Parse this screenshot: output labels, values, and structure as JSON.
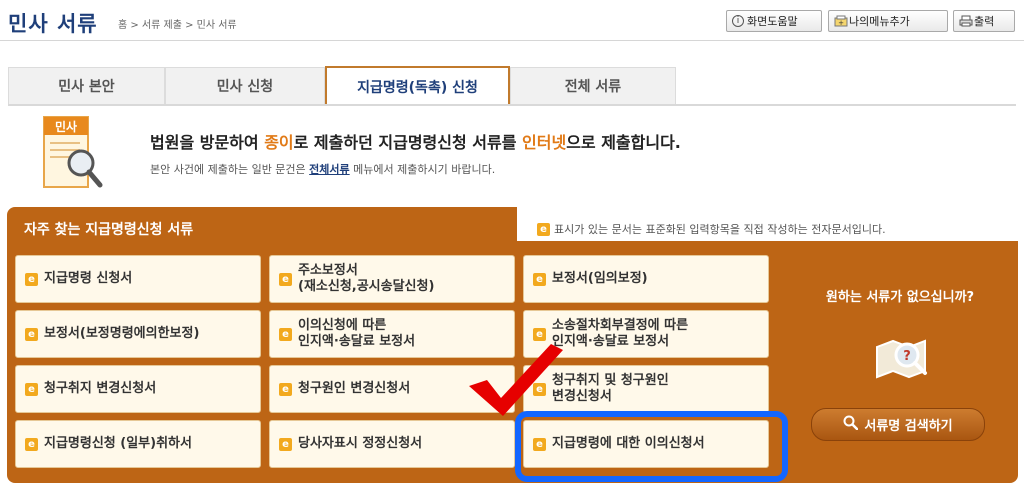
{
  "header": {
    "title": "민사 서류",
    "breadcrumb": "홈 > 서류 제출 > 민사 서류",
    "tools": [
      {
        "label": "화면도움말",
        "icon": "help-icon"
      },
      {
        "label": "나의메뉴추가",
        "icon": "add-menu-icon"
      },
      {
        "label": "출력",
        "icon": "print-icon"
      }
    ]
  },
  "tabs": [
    {
      "label": "민사 본안",
      "active": false
    },
    {
      "label": "민사 신청",
      "active": false
    },
    {
      "label": "지급명령(독촉) 신청",
      "active": true
    },
    {
      "label": "전체 서류",
      "active": false
    }
  ],
  "intro": {
    "icon_label": "민사",
    "main_parts": [
      "법원을 방문하여 ",
      "종이",
      "로 제출하던 지급명령신청 서류를 ",
      "인터넷",
      "으로 제출합니다."
    ],
    "sub_before": "본안 사건에 제출하는 일반 문건은 ",
    "sub_link": "전체서류",
    "sub_after": " 메뉴에서 제출하시기 바랍니다."
  },
  "panel": {
    "title": "자주 찾는 지급명령신청 서류",
    "legend": "표시가 있는 문서는 표준화된 입력항목을 직접 작성하는 전자문서입니다.",
    "documents": [
      [
        "지급명령 신청서",
        "주소보정서\n(재소신청,공시송달신청)",
        "보정서(임의보정)"
      ],
      [
        "보정서(보정명령에의한보정)",
        "이의신청에 따른\n인지액·송달료 보정서",
        "소송절차회부결정에 따른\n인지액·송달료 보정서"
      ],
      [
        "청구취지 변경신청서",
        "청구원인 변경신청서",
        "청구취지 및 청구원인\n변경신청서"
      ],
      [
        "지급명령신청 (일부)취하서",
        "당사자표시 정정신청서",
        "지급명령에 대한 이의신청서"
      ]
    ],
    "side_question": "원하는 서류가 없으십니까?",
    "search_button": "서류명 검색하기"
  },
  "colors": {
    "title_blue": "#1f3f7a",
    "panel_orange": "#bd6515",
    "accent_orange": "#e17a17",
    "highlight_blue": "#1366ff",
    "check_red": "#e60000"
  }
}
